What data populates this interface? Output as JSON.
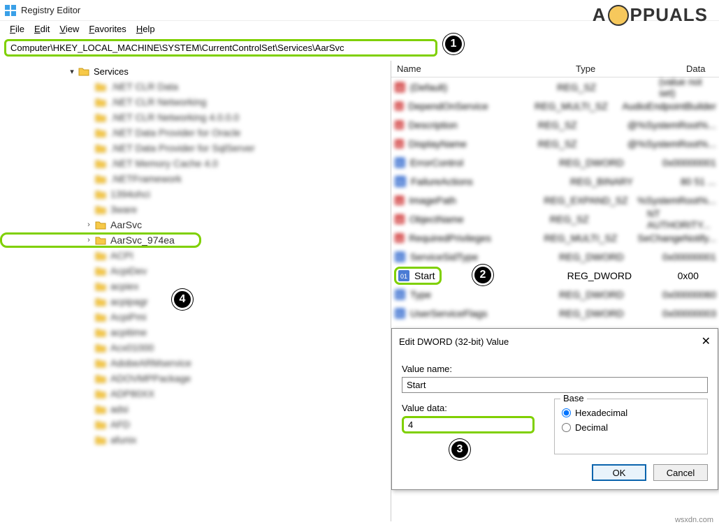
{
  "window": {
    "title": "Registry Editor"
  },
  "menu": {
    "file": "File",
    "edit": "Edit",
    "view": "View",
    "favorites": "Favorites",
    "help": "Help"
  },
  "address": {
    "path": "Computer\\HKEY_LOCAL_MACHINE\\SYSTEM\\CurrentControlSet\\Services\\AarSvc"
  },
  "tree": {
    "top_label": "Services",
    "items": [
      {
        "label": ".NET CLR Data",
        "blur": true
      },
      {
        "label": ".NET CLR Networking",
        "blur": true
      },
      {
        "label": ".NET CLR Networking 4.0.0.0",
        "blur": true
      },
      {
        "label": ".NET Data Provider for Oracle",
        "blur": true
      },
      {
        "label": ".NET Data Provider for SqlServer",
        "blur": true
      },
      {
        "label": ".NET Memory Cache 4.0",
        "blur": true
      },
      {
        "label": ".NETFramework",
        "blur": true
      },
      {
        "label": "1394ohci",
        "blur": true
      },
      {
        "label": "3ware",
        "blur": true
      },
      {
        "label": "AarSvc",
        "blur": false,
        "expandable": true
      },
      {
        "label": "AarSvc_974ea",
        "blur": false,
        "expandable": true,
        "highlight": true
      },
      {
        "label": "ACPI",
        "blur": true
      },
      {
        "label": "AcpiDev",
        "blur": true
      },
      {
        "label": "acpiex",
        "blur": true
      },
      {
        "label": "acpipagr",
        "blur": true
      },
      {
        "label": "AcpiPmi",
        "blur": true
      },
      {
        "label": "acpitime",
        "blur": true
      },
      {
        "label": "Acx01000",
        "blur": true
      },
      {
        "label": "AdobeARMservice",
        "blur": true
      },
      {
        "label": "ADOVMPPackage",
        "blur": true
      },
      {
        "label": "ADP80XX",
        "blur": true
      },
      {
        "label": "adsi",
        "blur": true
      },
      {
        "label": "AFD",
        "blur": true
      },
      {
        "label": "afunix",
        "blur": true
      }
    ]
  },
  "values": {
    "headers": {
      "name": "Name",
      "type": "Type",
      "data": "Data"
    },
    "rows": [
      {
        "name": "(Default)",
        "type": "REG_SZ",
        "data": "(value not set)",
        "icon": "str",
        "blur": true
      },
      {
        "name": "DependOnService",
        "type": "REG_MULTI_SZ",
        "data": "AudioEndpointBuilder",
        "icon": "str",
        "blur": true
      },
      {
        "name": "Description",
        "type": "REG_SZ",
        "data": "@%SystemRoot%...",
        "icon": "str",
        "blur": true
      },
      {
        "name": "DisplayName",
        "type": "REG_SZ",
        "data": "@%SystemRoot%...",
        "icon": "str",
        "blur": true
      },
      {
        "name": "ErrorControl",
        "type": "REG_DWORD",
        "data": "0x00000001",
        "icon": "bin",
        "blur": true
      },
      {
        "name": "FailureActions",
        "type": "REG_BINARY",
        "data": "80 51 ...",
        "icon": "bin",
        "blur": true
      },
      {
        "name": "ImagePath",
        "type": "REG_EXPAND_SZ",
        "data": "%SystemRoot%...",
        "icon": "str",
        "blur": true
      },
      {
        "name": "ObjectName",
        "type": "REG_SZ",
        "data": "NT AUTHORITY...",
        "icon": "str",
        "blur": true
      },
      {
        "name": "RequiredPrivileges",
        "type": "REG_MULTI_SZ",
        "data": "SeChangeNotify...",
        "icon": "str",
        "blur": true
      },
      {
        "name": "ServiceSidType",
        "type": "REG_DWORD",
        "data": "0x00000001",
        "icon": "bin",
        "blur": true
      },
      {
        "name": "Start",
        "type": "REG_DWORD",
        "data": "0x00",
        "icon": "bin",
        "blur": false,
        "highlight": true
      },
      {
        "name": "Type",
        "type": "REG_DWORD",
        "data": "0x00000060",
        "icon": "bin",
        "blur": true
      },
      {
        "name": "UserServiceFlags",
        "type": "REG_DWORD",
        "data": "0x00000003",
        "icon": "bin",
        "blur": true
      }
    ]
  },
  "dialog": {
    "title": "Edit DWORD (32-bit) Value",
    "value_name_label": "Value name:",
    "value_name": "Start",
    "value_data_label": "Value data:",
    "value_data": "4",
    "base_label": "Base",
    "hex_label": "Hexadecimal",
    "dec_label": "Decimal",
    "ok": "OK",
    "cancel": "Cancel"
  },
  "annotations": {
    "b1": "1",
    "b2": "2",
    "b3": "3",
    "b4": "4"
  },
  "logo": {
    "text_left": "A",
    "text_right": "PPUALS"
  },
  "watermark": "wsxdn.com"
}
